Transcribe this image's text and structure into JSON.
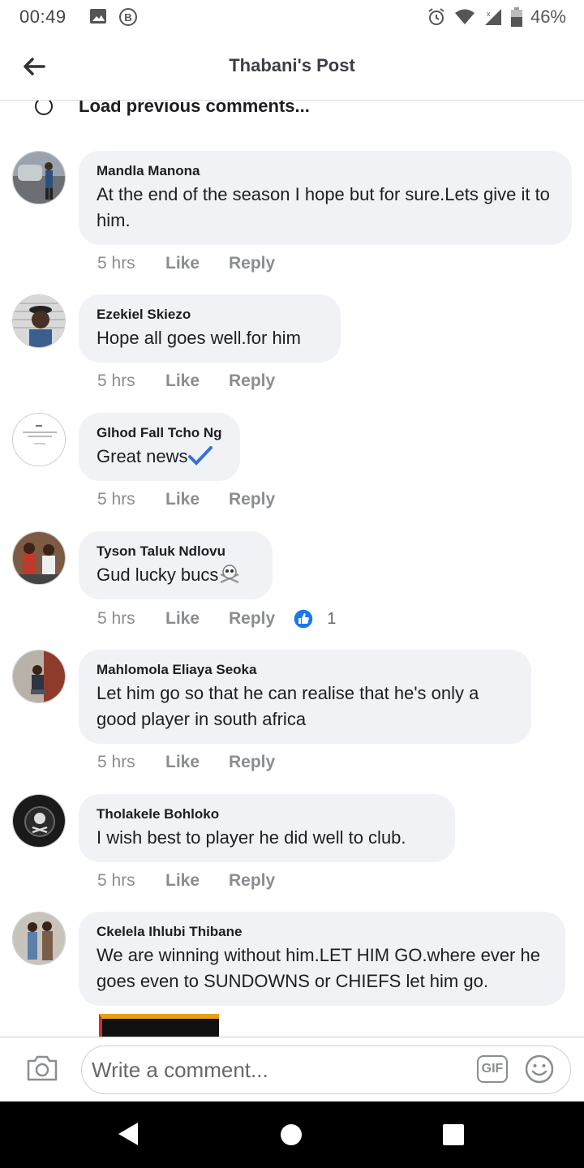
{
  "status_bar": {
    "time": "00:49",
    "battery": "46%",
    "icons": [
      "image-icon",
      "b-badge-icon",
      "alarm-icon",
      "wifi-icon",
      "signal-icon",
      "battery-icon"
    ]
  },
  "header": {
    "title": "Thabani's Post"
  },
  "feed": {
    "load_previous": "Load previous comments...",
    "comments": [
      {
        "name": "Mandla Manona",
        "text": "At the end of the season I hope but for sure.Lets give it to him.",
        "time": "5 hrs",
        "like": "Like",
        "reply": "Reply"
      },
      {
        "name": "Ezekiel Skiezo",
        "text": "Hope all goes well.for him",
        "time": "5 hrs",
        "like": "Like",
        "reply": "Reply"
      },
      {
        "name": "Glhod Fall Tcho Ng",
        "text": "Great news",
        "time": "5 hrs",
        "like": "Like",
        "reply": "Reply"
      },
      {
        "name": "Tyson Taluk Ndlovu",
        "text": "Gud lucky bucs",
        "time": "5 hrs",
        "like": "Like",
        "reply": "Reply",
        "reaction_count": "1"
      },
      {
        "name": "Mahlomola Eliaya Seoka",
        "text": "Let him go so that he can realise that he's only a good player in south africa",
        "time": "5 hrs",
        "like": "Like",
        "reply": "Reply"
      },
      {
        "name": "Tholakele Bohloko",
        "text": "I wish best to player he did well to club.",
        "time": "5 hrs",
        "like": "Like",
        "reply": "Reply"
      },
      {
        "name": "Ckelela Ihlubi Thibane",
        "text": "We are winning without him.LET HIM GO.where ever he goes even to SUNDOWNS or CHIEFS  let him go.",
        "time": "",
        "like": "",
        "reply": ""
      }
    ]
  },
  "composer": {
    "placeholder": "Write a comment...",
    "gif_label": "GIF"
  },
  "colors": {
    "bubble": "#f0f2f5",
    "like_blue": "#1877f2",
    "meta_gray": "#8a8d91"
  }
}
